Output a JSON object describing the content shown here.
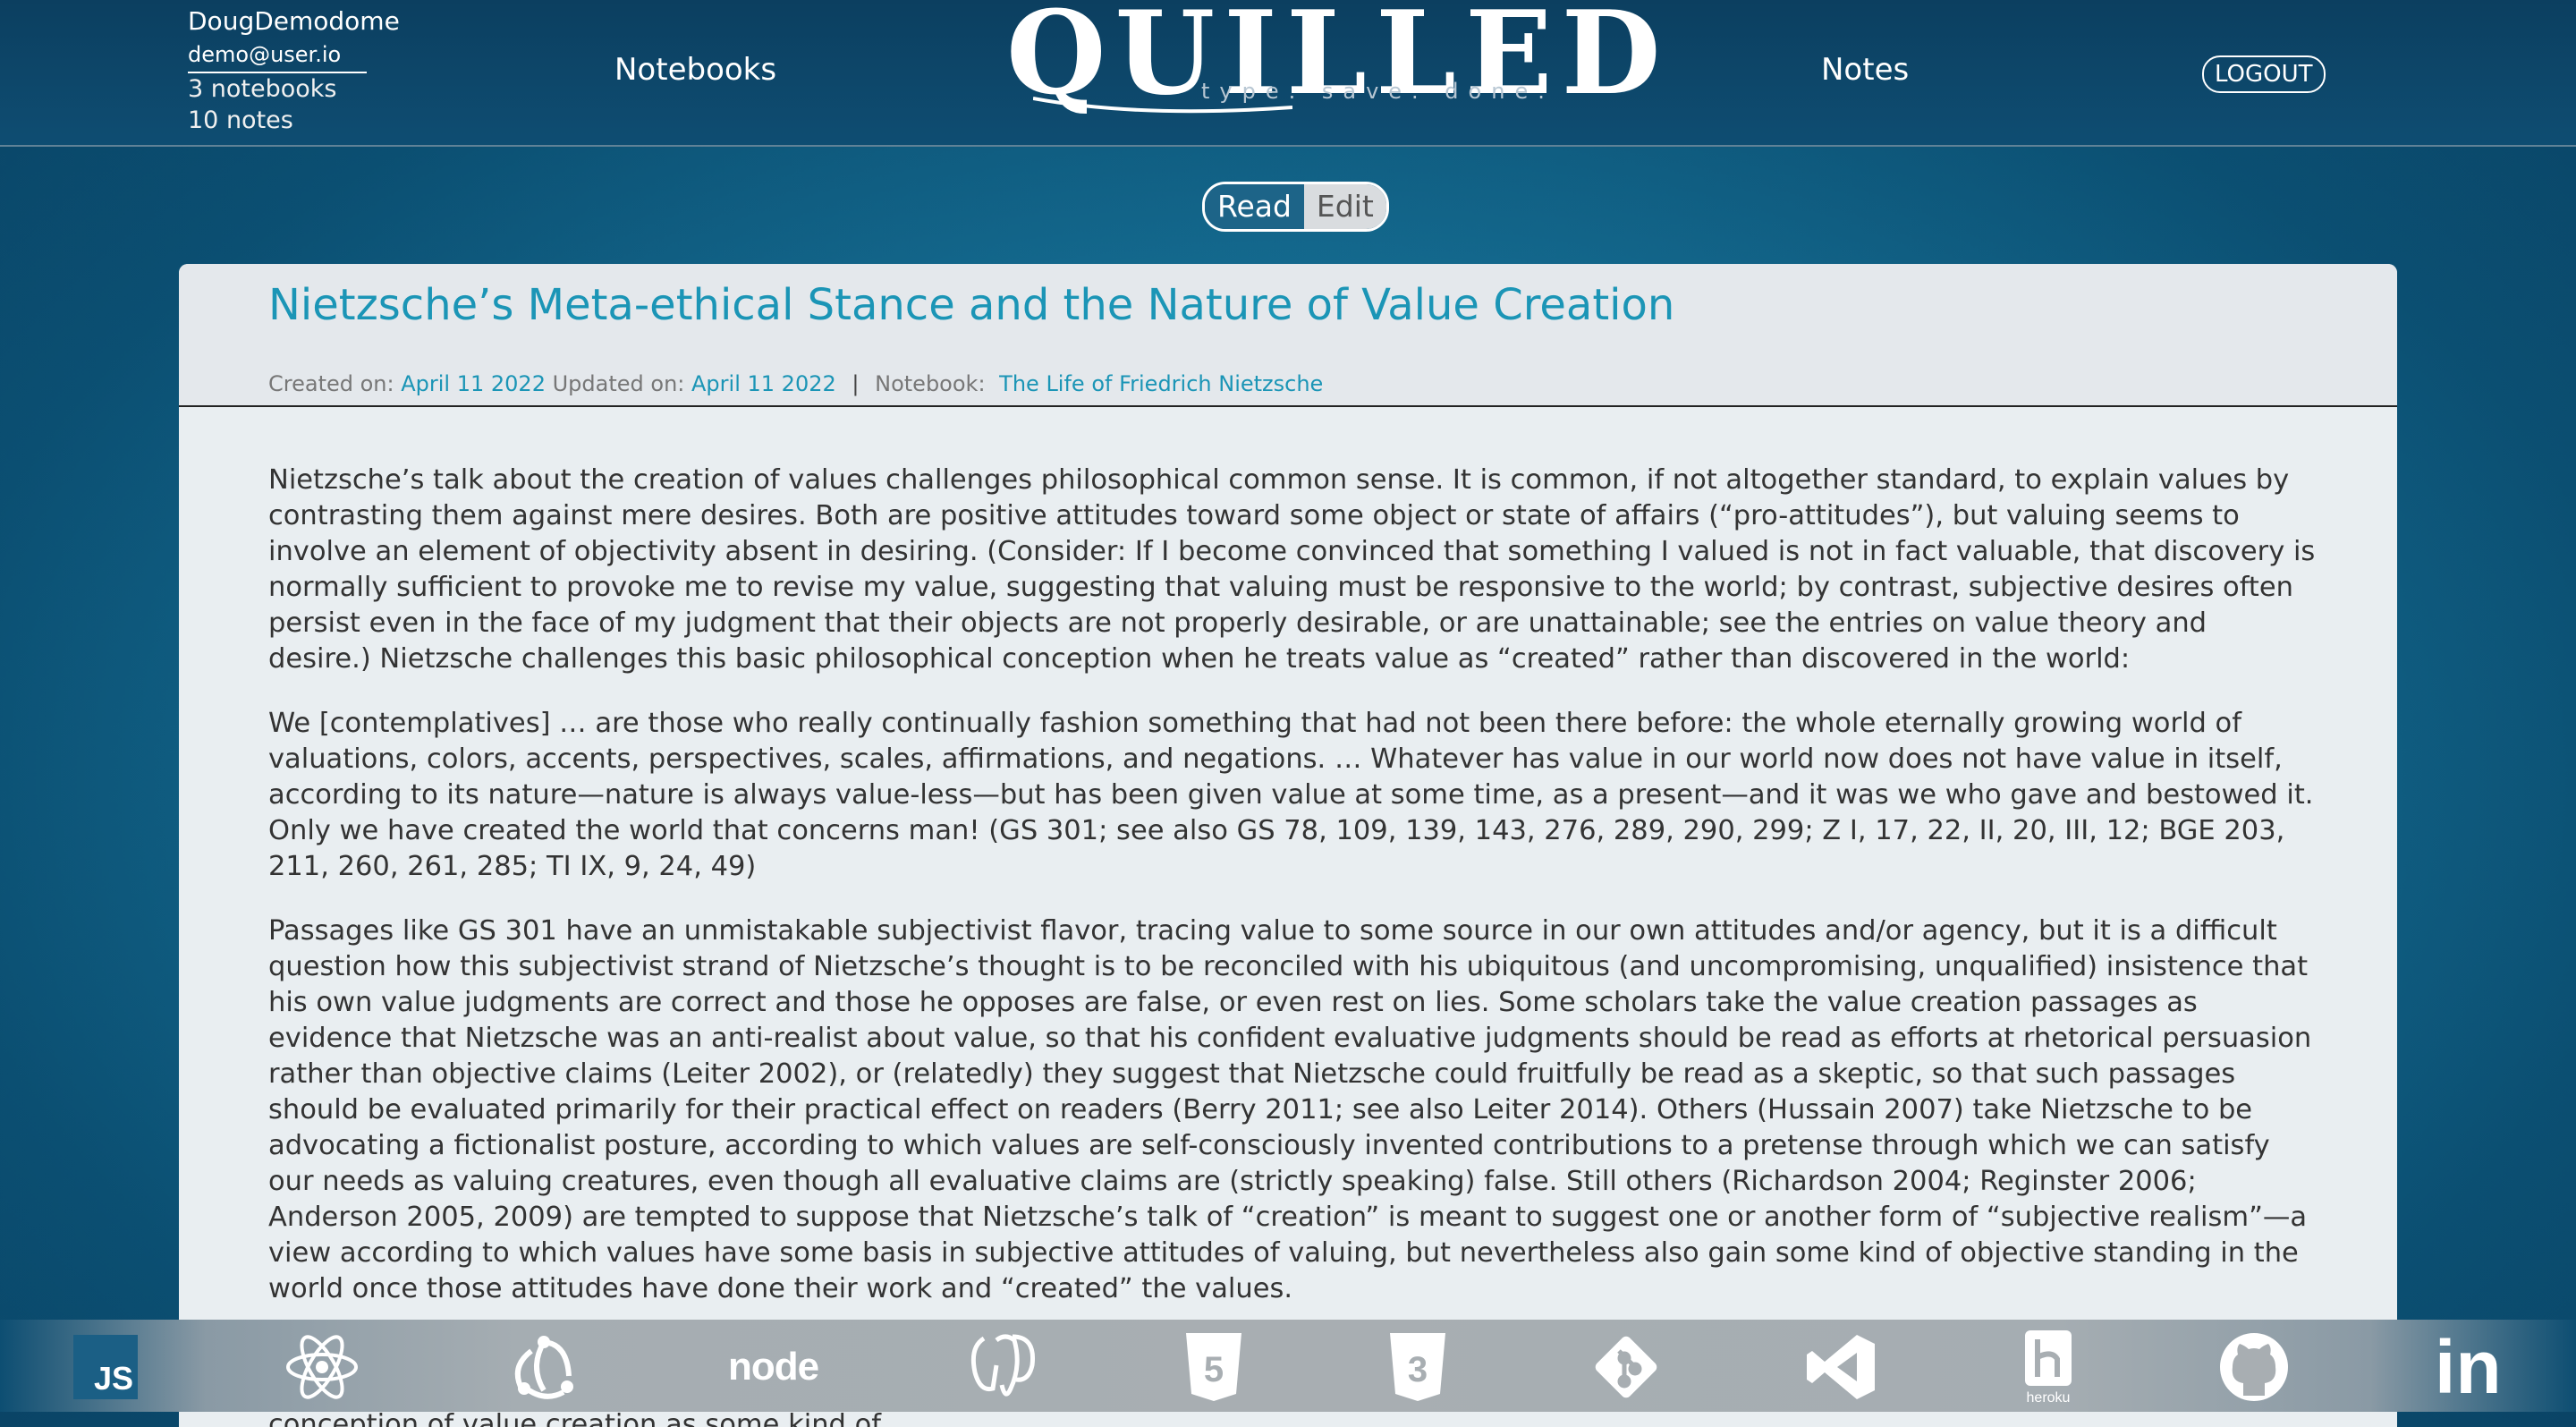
{
  "header": {
    "username": "DougDemodome",
    "email": "demo@user.io",
    "notebook_count": "3 notebooks",
    "note_count": "10 notes",
    "nav_notebooks": "Notebooks",
    "logo_text": "QUILLED",
    "logo_tagline": "type. save. done.",
    "nav_notes": "Notes",
    "logout_label": "LOGOUT"
  },
  "toggle": {
    "read_label": "Read",
    "edit_label": "Edit",
    "active": "Read"
  },
  "note": {
    "title": "Nietzsche’s Meta-ethical Stance and the Nature of Value Creation",
    "created_label": "Created on:",
    "created_date": "April 11 2022",
    "updated_label": "Updated on:",
    "updated_date": "April 11 2022",
    "notebook_label": "Notebook:",
    "notebook_name": "The Life of Friedrich Nietzsche",
    "paragraphs": [
      "Nietzsche’s talk about the creation of values challenges philosophical common sense. It is common, if not altogether standard, to explain values by contrasting them against mere desires. Both are positive attitudes toward some object or state of affairs (“pro-attitudes”), but valuing seems to involve an element of objectivity absent in desiring. (Consider: If I become convinced that something I valued is not in fact valuable, that discovery is normally sufficient to provoke me to revise my value, suggesting that valuing must be responsive to the world; by contrast, subjective desires often persist even in the face of my judgment that their objects are not properly desirable, or are unattainable; see the entries on value theory and desire.) Nietzsche challenges this basic philosophical conception when he treats value as “created” rather than discovered in the world:",
      "We [contemplatives] … are those who really continually fashion something that had not been there before: the whole eternally growing world of valuations, colors, accents, perspectives, scales, affirmations, and negations. … Whatever has value in our world now does not have value in itself, according to its nature—nature is always value-less—but has been given value at some time, as a present—and it was we who gave and bestowed it. Only we have created the world that concerns man! (GS 301; see also GS 78, 109, 139, 143, 276, 289, 290, 299; Z I, 17, 22, II, 20, III, 12; BGE 203, 211, 260, 261, 285; TI IX, 9, 24, 49)",
      "Passages like GS 301 have an unmistakable subjectivist flavor, tracing value to some source in our own attitudes and/or agency, but it is a difficult question how this subjectivist strand of Nietzsche’s thought is to be reconciled with his ubiquitous (and uncompromising, unqualified) insistence that his own value judgments are correct and those he opposes are false, or even rest on lies. Some scholars take the value creation passages as evidence that Nietzsche was an anti-realist about value, so that his confident evaluative judgments should be read as efforts at rhetorical persuasion rather than objective claims (Leiter 2002), or (relatedly) they suggest that Nietzsche could fruitfully be read as a skeptic, so that such passages should be evaluated primarily for their practical effect on readers (Berry 2011; see also Leiter 2014). Others (Hussain 2007) take Nietzsche to be advocating a fictionalist posture, according to which values are self-consciously invented contributions to a pretense through which we can satisfy our needs as valuing creatures, even though all evaluative claims are (strictly speaking) false. Still others (Richardson 2004; Reginster 2006; Anderson 2005, 2009) are tempted to suppose that Nietzsche’s talk of “creation” is meant to suggest one or another form of “subjective realism”—a view according to which values have some basis in subjective attitudes of valuing, but nevertheless also gain some kind of objective standing in the world once those attitudes have done their work and “created” the values.",
      "Nietzsche’s meta-ethical stance is treated elsewhere (see Section 3 of the entry on (Nietzsche’s moral and political philosophy; see also Hussain 2013, Huddleston 2014), so in lieu of detailed discussion, here are three textual observations. First, while a few passages appear to offer a conception of value creation as some kind of"
    ]
  },
  "footer_icons": [
    {
      "name": "javascript-icon",
      "label": "JS"
    },
    {
      "name": "react-icon"
    },
    {
      "name": "redux-icon"
    },
    {
      "name": "nodejs-icon",
      "label": "node"
    },
    {
      "name": "postgresql-icon"
    },
    {
      "name": "html5-icon",
      "label": "5"
    },
    {
      "name": "css3-icon",
      "label": "3"
    },
    {
      "name": "git-icon"
    },
    {
      "name": "vscode-icon"
    },
    {
      "name": "heroku-icon",
      "label": "heroku"
    },
    {
      "name": "github-icon"
    },
    {
      "name": "linkedin-icon",
      "label": "in"
    }
  ],
  "colors": {
    "accent": "#1b95b6",
    "header_bg": "#0c3f60",
    "card_bg": "#e9eef1",
    "footer_bg": "#a8aeb2"
  }
}
